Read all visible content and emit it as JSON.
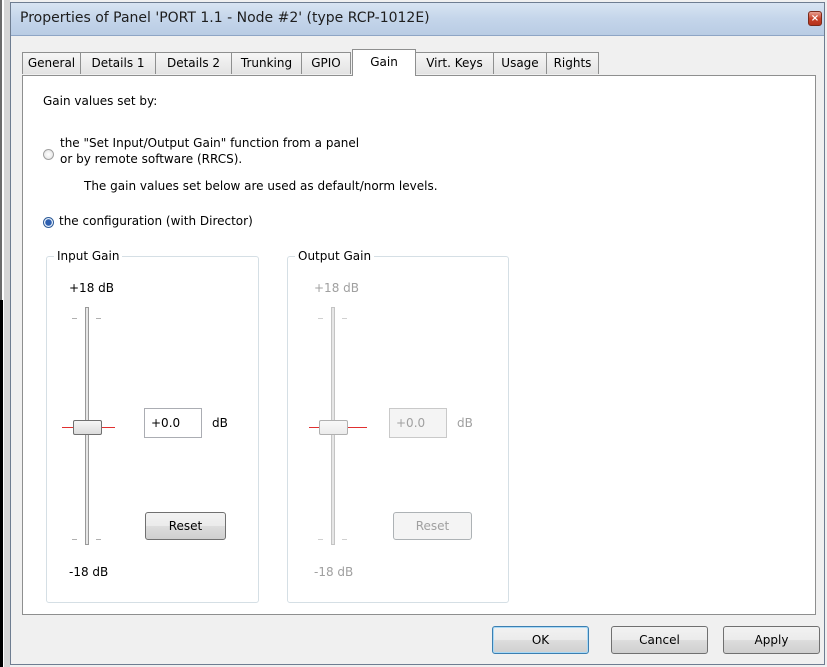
{
  "window": {
    "title": "Properties of Panel 'PORT 1.1 - Node #2' (type RCP-1012E)",
    "close_glyph": "×"
  },
  "tabs": [
    {
      "label": "General"
    },
    {
      "label": "Details 1"
    },
    {
      "label": "Details 2"
    },
    {
      "label": "Trunking"
    },
    {
      "label": "GPIO"
    },
    {
      "label": "Gain",
      "active": true
    },
    {
      "label": "Virt. Keys"
    },
    {
      "label": "Usage"
    },
    {
      "label": "Rights"
    }
  ],
  "gain": {
    "heading": "Gain values set by:",
    "option_panel_line1": "the \"Set Input/Output Gain\" function from a panel",
    "option_panel_line2": "or by remote software (RRCS).",
    "option_panel_note": "The gain values set below are used as default/norm levels.",
    "option_panel_selected": false,
    "option_config": "the configuration (with Director)",
    "option_config_selected": true
  },
  "input_gain": {
    "label": "Input Gain",
    "max_label": "+18 dB",
    "min_label": "-18 dB",
    "value": "+0.0",
    "unit": "dB",
    "slider_value_db": 0,
    "reset_label": "Reset",
    "enabled": true
  },
  "output_gain": {
    "label": "Output Gain",
    "max_label": "+18 dB",
    "min_label": "-18 dB",
    "value": "+0.0",
    "unit": "dB",
    "slider_value_db": 0,
    "reset_label": "Reset",
    "enabled": false
  },
  "buttons": {
    "ok": "OK",
    "cancel": "Cancel",
    "apply": "Apply"
  }
}
